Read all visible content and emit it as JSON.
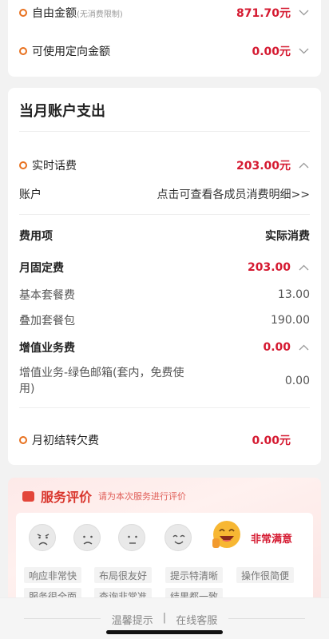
{
  "top_card": {
    "free_amount": {
      "label": "自由金额",
      "note": "(无消费限制)",
      "value": "871.70元"
    },
    "directed_amount": {
      "label": "可使用定向金额",
      "value": "0.00元"
    }
  },
  "monthly": {
    "title": "当月账户支出",
    "realtime": {
      "label": "实时话费",
      "value": "203.00元"
    },
    "account": {
      "label": "账户",
      "link": "点击可查看各成员消费明细>>"
    },
    "table_header": {
      "item": "费用项",
      "actual": "实际消费"
    },
    "fixed_fee": {
      "label": "月固定费",
      "value": "203.00"
    },
    "basic_plan": {
      "label": "基本套餐费",
      "value": "13.00"
    },
    "addon_pack": {
      "label": "叠加套餐包",
      "value": "190.00"
    },
    "vas_fee": {
      "label": "增值业务费",
      "value": "0.00"
    },
    "vas_mail": {
      "label": "增值业务-绿色邮箱(套内，免费使用)",
      "value": "0.00"
    },
    "carryover": {
      "label": "月初结转欠费",
      "value": "0.00元"
    }
  },
  "rating": {
    "title": "服务评价",
    "subtitle": "请为本次服务进行评价",
    "selected_label": "非常满意",
    "tags": [
      "响应非常快",
      "布局很友好",
      "提示特清晰",
      "操作很简便",
      "服务很全面",
      "查询非常准",
      "结果都一致"
    ]
  },
  "footer": {
    "tips": "温馨提示",
    "sep": "|",
    "service": "在线客服"
  },
  "colors": {
    "accent": "#d51a31",
    "dot": "#e8711f"
  }
}
